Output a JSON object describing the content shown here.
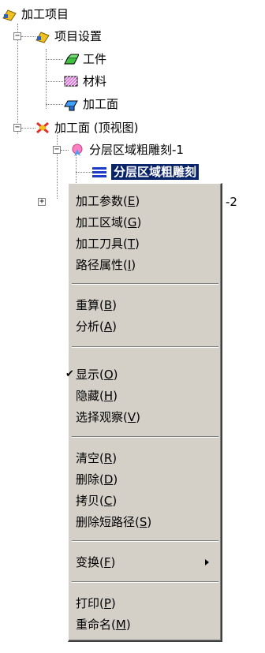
{
  "tree": {
    "root": {
      "label": "加工项目",
      "icon": "project-icon"
    },
    "settings": {
      "label": "项目设置",
      "icon": "project-settings-icon",
      "expander": "−"
    },
    "workpiece": {
      "label": "工件",
      "icon": "workpiece-icon"
    },
    "material": {
      "label": "材料",
      "icon": "material-icon"
    },
    "surface": {
      "label": "加工面",
      "icon": "machining-surface-icon"
    },
    "surface_view": {
      "label": "加工面 (顶视图)",
      "icon": "machining-view-icon",
      "expander": "−"
    },
    "roughing": {
      "label": "分层区域粗雕刻-1",
      "icon": "roughing-icon",
      "expander": "−"
    },
    "path_selected": {
      "label": "分层区域粗雕刻",
      "icon": "path-list-icon"
    },
    "path_partial": {
      "label": "-2",
      "expander": "+"
    }
  },
  "menu": {
    "params": {
      "text": "加工参数(",
      "key": "E",
      "close": ")"
    },
    "region": {
      "text": "加工区域(",
      "key": "G",
      "close": ")"
    },
    "tool": {
      "text": "加工刀具(",
      "key": "T",
      "close": ")"
    },
    "path_props": {
      "text": "路径属性(",
      "key": "I",
      "close": ")"
    },
    "recalc": {
      "text": "重算(",
      "key": "B",
      "close": ")"
    },
    "analyze": {
      "text": "分析(",
      "key": "A",
      "close": ")"
    },
    "show": {
      "text": "显示(",
      "key": "O",
      "close": ")",
      "check": "✔"
    },
    "hide": {
      "text": "隐藏(",
      "key": "H",
      "close": ")"
    },
    "select_view": {
      "text": "选择观察(",
      "key": "V",
      "close": ")"
    },
    "clear": {
      "text": "清空(",
      "key": "R",
      "close": ")"
    },
    "delete": {
      "text": "删除(",
      "key": "D",
      "close": ")"
    },
    "copy": {
      "text": "拷贝(",
      "key": "C",
      "close": ")"
    },
    "delete_short": {
      "text": "删除短路径(",
      "key": "S",
      "close": ")"
    },
    "transform": {
      "text": "变换(",
      "key": "F",
      "close": ")"
    },
    "print": {
      "text": "打印(",
      "key": "P",
      "close": ")"
    },
    "rename": {
      "text": "重命名(",
      "key": "M",
      "close": ")"
    }
  },
  "colors": {
    "selection": "#0a246a",
    "menu_bg": "#d4d0c8"
  }
}
